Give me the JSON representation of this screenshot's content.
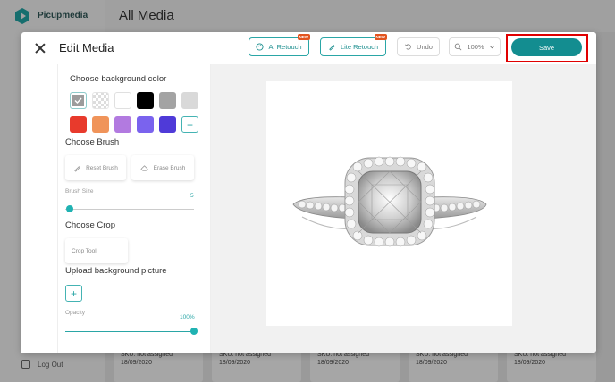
{
  "app": {
    "logo_text": "Picupmedia",
    "page_title": "All Media",
    "logout_label": "Log Out",
    "cards": [
      {
        "sku": "SKU: not assigned",
        "date": "18/09/2020"
      },
      {
        "sku": "SKU: not assigned",
        "date": "18/09/2020"
      },
      {
        "sku": "SKU: not assigned",
        "date": "18/09/2020"
      },
      {
        "sku": "SKU: not assigned",
        "date": "18/09/2020"
      },
      {
        "sku": "SKU: not assigned",
        "date": "18/09/2020"
      }
    ]
  },
  "modal": {
    "title": "Edit Media",
    "toolbar": {
      "ai_retouch": "AI Retouch",
      "lite_retouch": "Lite Retouch",
      "new_badge": "NEW",
      "undo": "Undo",
      "zoom": "100%",
      "save": "Save"
    },
    "panel": {
      "bg_color_title": "Choose background color",
      "swatches": [
        "selected-grey",
        "transparent",
        "#ffffff",
        "#000000",
        "#a3a3a3",
        "#d9d9d9",
        "#e83a2c",
        "#f0945a",
        "#b27ae0",
        "#7a63ee",
        "#4f3ad8"
      ],
      "brush_title": "Choose Brush",
      "reset_brush": "Reset Brush",
      "erase_brush": "Erase Brush",
      "brush_size_label": "Brush Size",
      "brush_size_value": "5",
      "crop_title": "Choose Crop",
      "crop_tool": "Crop Tool",
      "upload_title": "Upload background picture",
      "opacity_label": "Opacity",
      "opacity_value": "100%"
    }
  },
  "colors": {
    "accent": "#138d90",
    "highlight": "#e00000",
    "badge": "#e2541f"
  }
}
